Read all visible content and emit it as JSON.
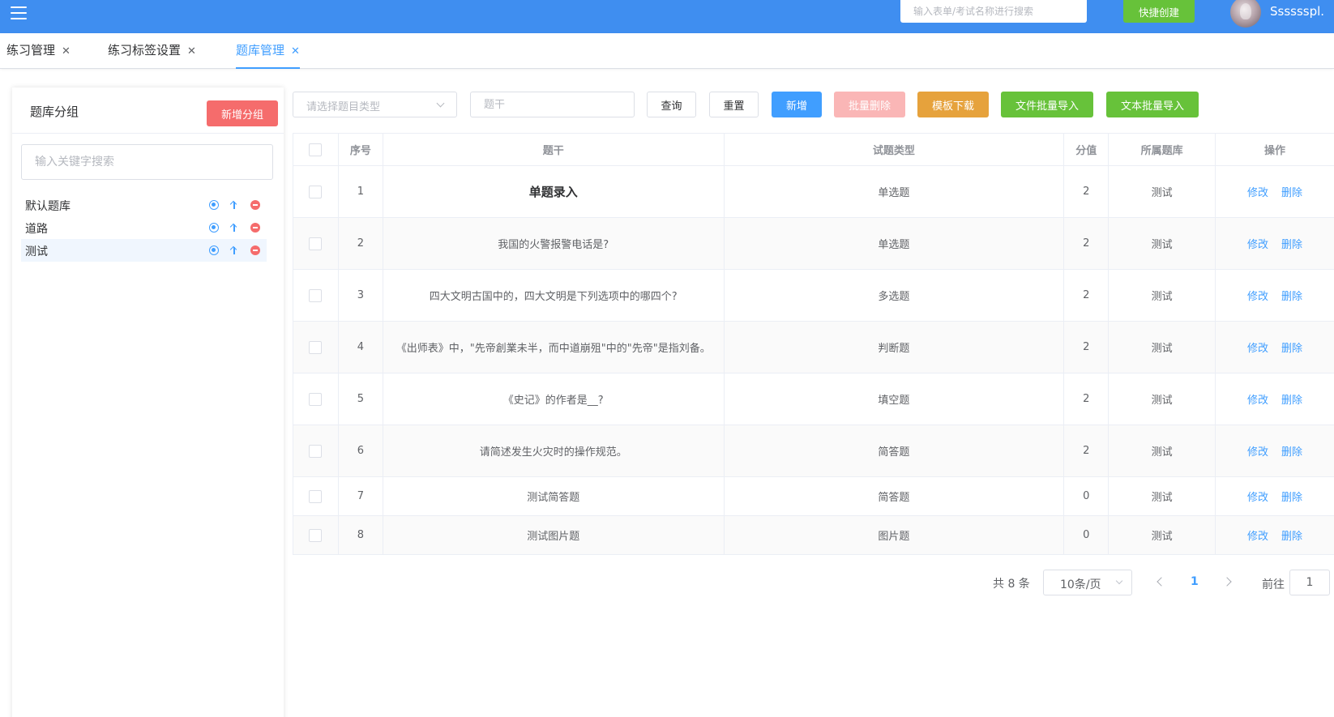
{
  "header": {
    "search_placeholder": "输入表单/考试名称进行搜索",
    "quick_create_label": "快捷创建",
    "username": "Sssssspl.",
    "bg_color": "#3f8ef0"
  },
  "tabs": [
    {
      "label": "练习管理",
      "active": false
    },
    {
      "label": "练习标签设置",
      "active": false
    },
    {
      "label": "题库管理",
      "active": true
    }
  ],
  "sidebar": {
    "title": "题库分组",
    "add_group_label": "新增分组",
    "search_placeholder": "输入关键字搜索",
    "groups": [
      {
        "name": "默认题库",
        "selected": false
      },
      {
        "name": "道路",
        "selected": false
      },
      {
        "name": "测试",
        "selected": true
      }
    ]
  },
  "toolbar": {
    "type_select_placeholder": "请选择题目类型",
    "stem_placeholder": "题干",
    "query_label": "查询",
    "reset_label": "重置",
    "add_label": "新增",
    "batch_delete_label": "批量删除",
    "template_download_label": "模板下载",
    "file_import_label": "文件批量导入",
    "text_import_label": "文本批量导入"
  },
  "table": {
    "headers": [
      "序号",
      "题干",
      "试题类型",
      "分值",
      "所属题库",
      "操作"
    ],
    "rows": [
      {
        "no": "1",
        "stem": "单题录入",
        "type": "单选题",
        "score": "2",
        "bank": "测试"
      },
      {
        "no": "2",
        "stem": "我国的火警报警电话是?",
        "type": "单选题",
        "score": "2",
        "bank": "测试"
      },
      {
        "no": "3",
        "stem": "四大文明古国中的，四大文明是下列选项中的哪四个?",
        "type": "多选题",
        "score": "2",
        "bank": "测试"
      },
      {
        "no": "4",
        "stem": "《出师表》中，\"先帝創業未半，而中道崩殂\"中的\"先帝\"是指刘备。",
        "type": "判断题",
        "score": "2",
        "bank": "测试"
      },
      {
        "no": "5",
        "stem": "《史记》的作者是__?",
        "type": "填空题",
        "score": "2",
        "bank": "测试"
      },
      {
        "no": "6",
        "stem": "请简述发生火灾时的操作规范。",
        "type": "简答题",
        "score": "2",
        "bank": "测试"
      },
      {
        "no": "7",
        "stem": "测试简答题",
        "type": "简答题",
        "score": "0",
        "bank": "测试"
      },
      {
        "no": "8",
        "stem": "测试图片题",
        "type": "图片题",
        "score": "0",
        "bank": "测试"
      }
    ],
    "edit_label": "修改",
    "delete_label": "删除"
  },
  "pagination": {
    "total_text": "共 8 条",
    "page_size": "10条/页",
    "current_page": "1",
    "goto_label": "前往",
    "goto_value": "1"
  }
}
